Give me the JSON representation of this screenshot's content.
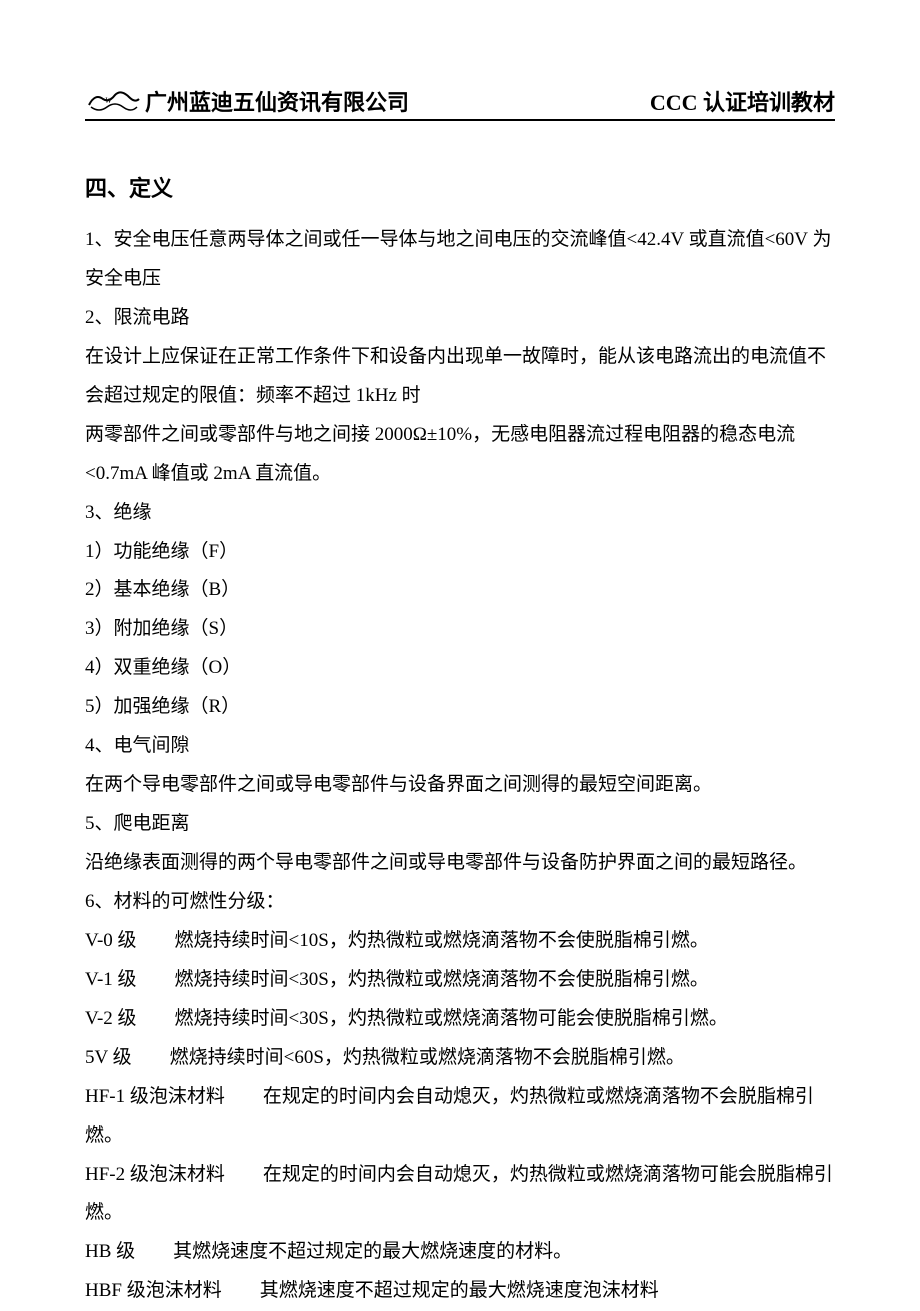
{
  "header": {
    "company": "广州蓝迪五仙资讯有限公司",
    "docTitle": "CCC 认证培训教材"
  },
  "section": {
    "title": "四、定义",
    "lines": [
      "1、安全电压任意两导体之间或任一导体与地之间电压的交流峰值<42.4V 或直流值<60V 为安全电压",
      "2、限流电路",
      "在设计上应保证在正常工作条件下和设备内出现单一故障时，能从该电路流出的电流值不会超过规定的限值：频率不超过 1kHz 时",
      "两零部件之间或零部件与地之间接 2000Ω±10%，无感电阻器流过程电阻器的稳态电流<0.7mA 峰值或 2mA 直流值。",
      "3、绝缘",
      "1）功能绝缘（F）",
      "2）基本绝缘（B）",
      "3）附加绝缘（S）",
      "4）双重绝缘（O）",
      "5）加强绝缘（R）",
      "4、电气间隙",
      "在两个导电零部件之间或导电零部件与设备界面之间测得的最短空间距离。",
      "5、爬电距离",
      "沿绝缘表面测得的两个导电零部件之间或导电零部件与设备防护界面之间的最短路径。",
      "6、材料的可燃性分级：",
      "V-0 级　　燃烧持续时间<10S，灼热微粒或燃烧滴落物不会使脱脂棉引燃。",
      "V-1 级　　燃烧持续时间<30S，灼热微粒或燃烧滴落物不会使脱脂棉引燃。",
      "V-2 级　　燃烧持续时间<30S，灼热微粒或燃烧滴落物可能会使脱脂棉引燃。",
      "5V 级　　燃烧持续时间<60S，灼热微粒或燃烧滴落物不会脱脂棉引燃。",
      "HF-1 级泡沫材料　　在规定的时间内会自动熄灭，灼热微粒或燃烧滴落物不会脱脂棉引燃。",
      "HF-2 级泡沫材料　　在规定的时间内会自动熄灭，灼热微粒或燃烧滴落物可能会脱脂棉引燃。",
      "HB 级　　其燃烧速度不超过规定的最大燃烧速度的材料。",
      "HBF 级泡沫材料　　其燃烧速度不超过规定的最大燃烧速度泡沫材料"
    ]
  }
}
